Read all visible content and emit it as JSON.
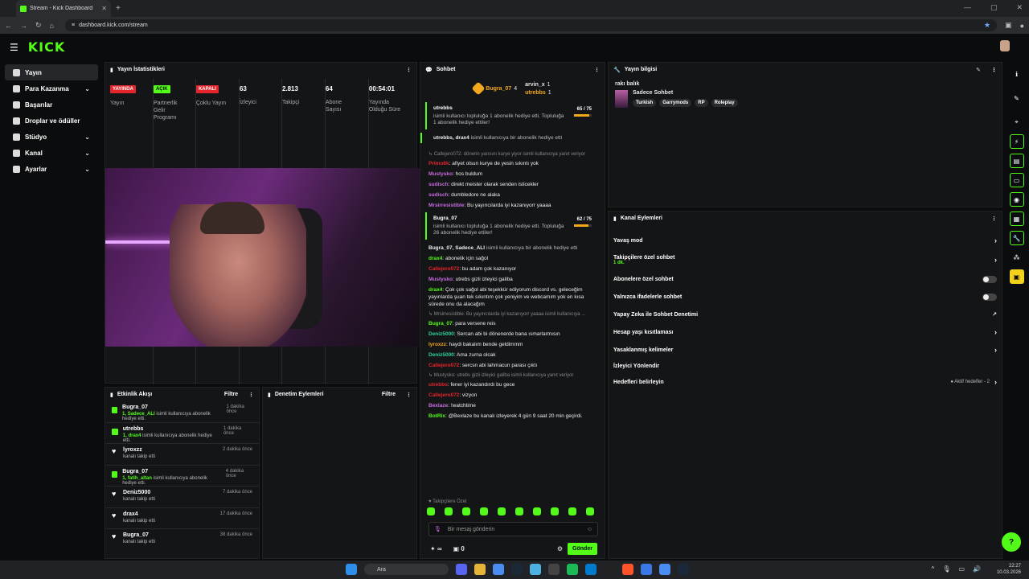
{
  "browser": {
    "tab_title": "Stream - Kick Dashboard",
    "url": "dashboard.kick.com/stream"
  },
  "brand": {
    "logo": "KICK",
    "accent": "#53fc18"
  },
  "sidebar": {
    "items": [
      {
        "label": "Yayın",
        "active": true,
        "icon": "broadcast-icon"
      },
      {
        "label": "Para Kazanma",
        "expand": true,
        "icon": "money-icon"
      },
      {
        "label": "Başarılar",
        "icon": "trophy-icon"
      },
      {
        "label": "Droplar ve ödüller",
        "icon": "gift-icon"
      },
      {
        "label": "Stüdyo",
        "expand": true,
        "icon": "studio-icon"
      },
      {
        "label": "Kanal",
        "expand": true,
        "icon": "channel-icon"
      },
      {
        "label": "Ayarlar",
        "expand": true,
        "icon": "settings-icon"
      }
    ]
  },
  "stats": {
    "title": "Yayın İstatistikleri",
    "items": [
      {
        "badge": "YAYINDA",
        "badge_color": "red",
        "label": "Yayın"
      },
      {
        "badge": "AÇIK",
        "badge_color": "green",
        "label": "Partnerlik Gelir Programı"
      },
      {
        "badge": "KAPALI",
        "badge_color": "red",
        "label": "Çoklu Yayın"
      },
      {
        "value": "63",
        "label": "İzleyici"
      },
      {
        "value": "2.813",
        "label": "Takipçi"
      },
      {
        "value": "64",
        "label": "Abone Sayısı"
      },
      {
        "value": "00:54:01",
        "label": "Yayında Olduğu Süre"
      }
    ]
  },
  "activity": {
    "title": "Etkinlik Akışı",
    "filter": "Filtre",
    "items": [
      {
        "type": "gift",
        "name": "Bugra_07",
        "count": "1, Sadece_ALI",
        "rest": " isimli kullanıcıya abonelik hediye etti.",
        "time": "1 dakika önce"
      },
      {
        "type": "gift",
        "name": "utrebbs",
        "count": "1, drax4",
        "rest": " isimli kullanıcıya abonelik hediye etti.",
        "time": "1 dakika önce"
      },
      {
        "type": "follow",
        "name": "lyroxzz",
        "count": "",
        "rest": "kanalı takip etti",
        "time": "2 dakika önce"
      },
      {
        "type": "gift",
        "name": "Bugra_07",
        "count": "1, fatih_altan",
        "rest": " isimli kullanıcıya abonelik hediye etti.",
        "time": "4 dakika önce"
      },
      {
        "type": "follow",
        "name": "Deniz5000",
        "count": "",
        "rest": "kanalı takip etti",
        "time": "7 dakika önce"
      },
      {
        "type": "follow",
        "name": "drax4",
        "count": "",
        "rest": "kanalı takip etti",
        "time": "17 dakika önce"
      },
      {
        "type": "follow",
        "name": "Bugra_07",
        "count": "",
        "rest": "kanalı takip etti",
        "time": "38 dakika önce"
      }
    ]
  },
  "moderation": {
    "title": "Denetim Eylemleri",
    "filter": "Filtre"
  },
  "chat": {
    "title": "Sohbet",
    "pinned": {
      "top_name": "Bugra_07",
      "top_count": "4",
      "second": "arvin_x",
      "second_count": "1",
      "third": "utrebbs",
      "third_count": "1"
    },
    "sub1": {
      "name": "utrebbs",
      "text": "isimli kullanıcı topluluğa 1 abonelik hediye etti. Topluluğa 1 abonelik hediye ettiler!",
      "count": "65 / 75",
      "progress": 0.87
    },
    "gift1": {
      "names": "utrebbs, drax4",
      "text": " isimli kullanıcıya bir abonelik hediye etti"
    },
    "reply1": "↳ Callejero072: dönerin yarısını kurye yiyor isimli kullanıcıya yanıt veriyor",
    "messages1": [
      {
        "user": "Primo6k",
        "color": "#e5252d",
        "text": ": afiyet olsun kurye de yesin sıkıntı yok"
      },
      {
        "user": "Mustysko",
        "color": "#c86ce0",
        "text": ": hos buldum"
      },
      {
        "user": "sudisch",
        "color": "#c86ce0",
        "text": ": direkt meister olarak senden isticekler"
      },
      {
        "user": "sudisch",
        "color": "#c86ce0",
        "text": ": dumbledore ne alaka"
      },
      {
        "user": "Mrsirresistible",
        "color": "#c86ce0",
        "text": ": Bu yayıncılarda iyi kazanıyorr yaaaa"
      }
    ],
    "sub2": {
      "name": "Bugra_07",
      "text": "isimli kullanıcı topluluğa 1 abonelik hediye etti. Topluluğa 26 abonelik hediye ettiler!",
      "count": "62 / 75",
      "progress": 0.83
    },
    "gift2": {
      "names": "Bugra_07, Sadece_ALI",
      "text": " isimli kullanıcıya bir abonelik hediye etti"
    },
    "messages2": [
      {
        "user": "drax4",
        "color": "#53fc18",
        "text": ": abonelik için sağol"
      },
      {
        "user": "Callejero072",
        "color": "#e5252d",
        "text": ": bu adam çok kazanıyor"
      },
      {
        "user": "Mustysko",
        "color": "#c86ce0",
        "text": ": utrebs gizli izleyici galiba"
      },
      {
        "user": "drax4",
        "color": "#53fc18",
        "text": ": Çok çok sağol abi teşekkür ediyorum discord vs. geleceğim yayınlarda şuan tek sıkıntım çok yeniyim ve webcamım yok en kısa sürede onu da alacağım"
      }
    ],
    "reply2": "↳ Mrsirresistible: Bu yayıncılarda iyi kazanıyorr yaaaa isimli kullanıcıya ...",
    "messages3": [
      {
        "user": "Bugra_07",
        "color": "#53fc18",
        "text": ": para versene reis"
      },
      {
        "user": "Deniz5000",
        "color": "#2bd1a0",
        "text": ": Sercan abi bi dönenerde bana ısmarlarmısın"
      },
      {
        "user": "lyroxzz",
        "color": "#f2a81d",
        "text": ": haydi bakalım bende geldimmm"
      },
      {
        "user": "Deniz5000",
        "color": "#2bd1a0",
        "text": ": Ama zurna olcak"
      },
      {
        "user": "Callejero072",
        "color": "#e5252d",
        "text": ": sercsn abi lahmacun parası çıktı"
      }
    ],
    "reply3": "↳ Mustysko: utrebs gizli izleyici galiba isimli kullanıcıya yanıt veriyor",
    "messages4": [
      {
        "user": "utrebbs",
        "color": "#e5252d",
        "text": ": fener iyi kazandırdı bu gece"
      },
      {
        "user": "Callejero072",
        "color": "#e5252d",
        "text": ": vizyon"
      },
      {
        "user": "Bexlaze",
        "color": "#c86ce0",
        "text": ": !watchtime"
      },
      {
        "user": "BotRix",
        "color": "#53fc18",
        "text": ": @Bexlaze bu kanalı izleyerek 4 gün 9 saat 20 min geçirdi."
      }
    ],
    "followers_only": "♥ Takipçilere Özel",
    "input_placeholder": "Bir mesaj gönderin",
    "points": "∞",
    "drops": "0",
    "send": "Gönder"
  },
  "stream_info": {
    "title": "Yayın bilgisi",
    "stream_title": "rakı balık",
    "category": "Sadece Sohbet",
    "tags": [
      "Turkish",
      "Garrymods",
      "RP",
      "Roleplay"
    ]
  },
  "channel_actions": {
    "title": "Kanal Eylemleri",
    "rows": [
      {
        "label": "Yavaş mod",
        "control": "arrow"
      },
      {
        "label": "Takipçilere özel sohbet",
        "sub": "1 dk.",
        "control": "arrow"
      },
      {
        "label": "Abonelere özel sohbet",
        "control": "toggle"
      },
      {
        "label": "Yalnızca ifadelerle sohbet",
        "control": "toggle"
      },
      {
        "label": "Yapay Zeka ile Sohbet Denetimi",
        "control": "external"
      },
      {
        "label": "Hesap yaşı kısıtlaması",
        "control": "arrow"
      },
      {
        "label": "Yasaklanmış kelimeler",
        "control": "arrow"
      },
      {
        "label": "İzleyici Yönlendir",
        "control": "none"
      },
      {
        "label": "Hedefleri belirleyin",
        "extra": "● Aktif hedefler - 2",
        "control": "arrow"
      }
    ]
  },
  "taskbar": {
    "search": "Ara",
    "time": "22:27",
    "date": "10.03.2026"
  }
}
